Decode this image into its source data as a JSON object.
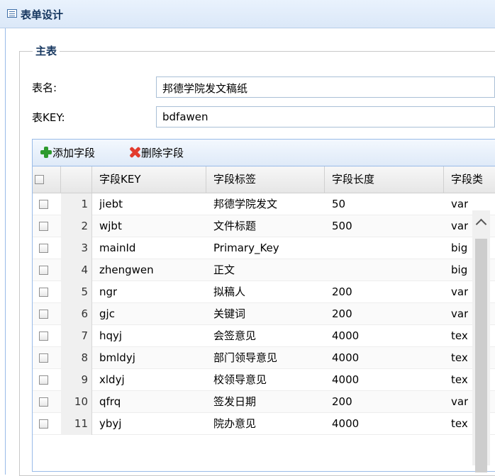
{
  "window": {
    "title": "表单设计"
  },
  "fieldset": {
    "legend": "主表"
  },
  "form": {
    "name_label": "表名:",
    "name_value": "邦德学院发文稿纸",
    "key_label": "表KEY:",
    "key_value": "bdfawen"
  },
  "toolbar": {
    "add_label": "添加字段",
    "delete_label": "删除字段"
  },
  "table": {
    "columns": [
      "字段KEY",
      "字段标签",
      "字段长度",
      "字段类"
    ],
    "rows": [
      {
        "num": "1",
        "key": "jiebt",
        "label": "邦德学院发文",
        "length": "50",
        "type": "var"
      },
      {
        "num": "2",
        "key": "wjbt",
        "label": "文件标题",
        "length": "500",
        "type": "var"
      },
      {
        "num": "3",
        "key": "mainId",
        "label": "Primary_Key",
        "length": "",
        "type": "big"
      },
      {
        "num": "4",
        "key": "zhengwen",
        "label": "正文",
        "length": "",
        "type": "big"
      },
      {
        "num": "5",
        "key": "ngr",
        "label": "拟稿人",
        "length": "200",
        "type": "var"
      },
      {
        "num": "6",
        "key": "gjc",
        "label": "关键词",
        "length": "200",
        "type": "var"
      },
      {
        "num": "7",
        "key": "hqyj",
        "label": "会签意见",
        "length": "4000",
        "type": "tex"
      },
      {
        "num": "8",
        "key": "bmldyj",
        "label": "部门领导意见",
        "length": "4000",
        "type": "tex"
      },
      {
        "num": "9",
        "key": "xldyj",
        "label": "校领导意见",
        "length": "4000",
        "type": "tex"
      },
      {
        "num": "10",
        "key": "qfrq",
        "label": "签发日期",
        "length": "200",
        "type": "var"
      },
      {
        "num": "11",
        "key": "ybyj",
        "label": "院办意见",
        "length": "4000",
        "type": "tex"
      }
    ]
  }
}
